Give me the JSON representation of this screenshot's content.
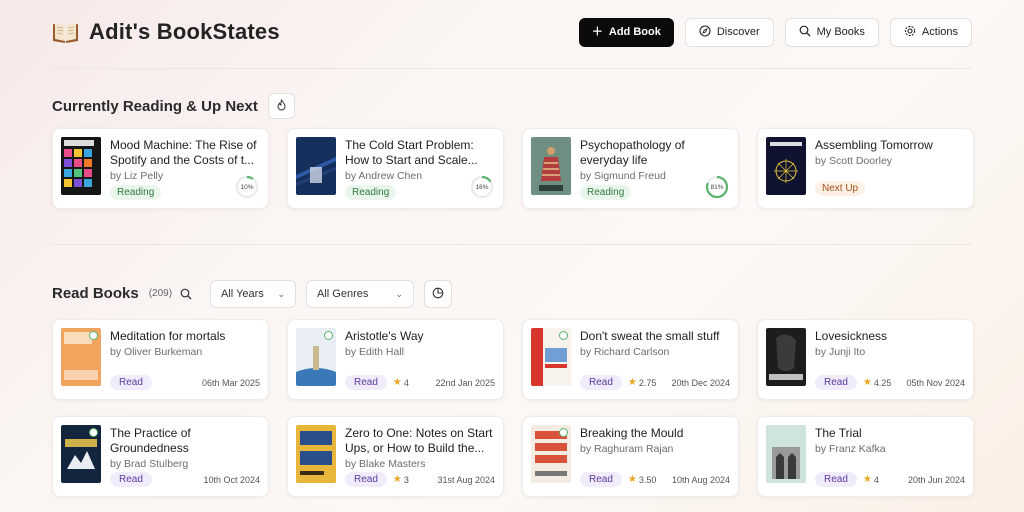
{
  "header": {
    "logo_icon": "open-book-icon",
    "title": "Adit's BookStates",
    "buttons": [
      {
        "label": "Add Book",
        "icon": "plus-icon"
      },
      {
        "label": "Discover",
        "icon": "compass-icon"
      },
      {
        "label": "My Books",
        "icon": "search-icon"
      },
      {
        "label": "Actions",
        "icon": "gear-icon"
      }
    ]
  },
  "current": {
    "title": "Currently Reading & Up Next",
    "books": [
      {
        "title": "Mood Machine: The Rise of Spotify and the Costs of t...",
        "author": "by Liz Pelly",
        "status": "Reading",
        "progress_label": "10%",
        "progress": 0.1
      },
      {
        "title": "The Cold Start Problem: How to Start and Scale...",
        "author": "by Andrew Chen",
        "status": "Reading",
        "progress_label": "16%",
        "progress": 0.16
      },
      {
        "title": "Psychopathology of everyday life",
        "author": "by Sigmund Freud",
        "status": "Reading",
        "progress_label": "81%",
        "progress": 0.81
      },
      {
        "title": "Assembling Tomorrow",
        "author": "by Scott Doorley",
        "status": "Next Up"
      }
    ]
  },
  "read": {
    "title": "Read Books",
    "count": "(209)",
    "filters": {
      "years": "All Years",
      "genres": "All Genres"
    },
    "books": [
      {
        "title": "Meditation for mortals",
        "author": "by Oliver Burkeman",
        "status": "Read",
        "rating": "",
        "date": "06th Mar 2025"
      },
      {
        "title": "Aristotle's Way",
        "author": "by Edith Hall",
        "status": "Read",
        "rating": "4",
        "date": "22nd Jan 2025"
      },
      {
        "title": "Don't sweat the small stuff",
        "author": "by Richard Carlson",
        "status": "Read",
        "rating": "2.75",
        "date": "20th Dec 2024"
      },
      {
        "title": "Lovesickness",
        "author": "by Junji Ito",
        "status": "Read",
        "rating": "4.25",
        "date": "05th Nov 2024"
      },
      {
        "title": "The Practice of Groundedness",
        "author": "by Brad Stulberg",
        "status": "Read",
        "rating": "",
        "date": "10th Oct 2024"
      },
      {
        "title": "Zero to One: Notes on Start Ups, or How to Build the...",
        "author": "by Blake Masters",
        "status": "Read",
        "rating": "3",
        "date": "31st Aug 2024"
      },
      {
        "title": "Breaking the Mould",
        "author": "by Raghuram Rajan",
        "status": "Read",
        "rating": "3.50",
        "date": "10th Aug 2024"
      },
      {
        "title": "The Trial",
        "author": "by Franz Kafka",
        "status": "Read",
        "rating": "4",
        "date": "20th Jun 2024"
      }
    ]
  },
  "colors": {
    "accent_reading": "#2f7a3d",
    "accent_next": "#a3521b",
    "accent_read": "#5b3a9e",
    "star": "#e8a520",
    "progress_ring": "#5bb36b"
  }
}
